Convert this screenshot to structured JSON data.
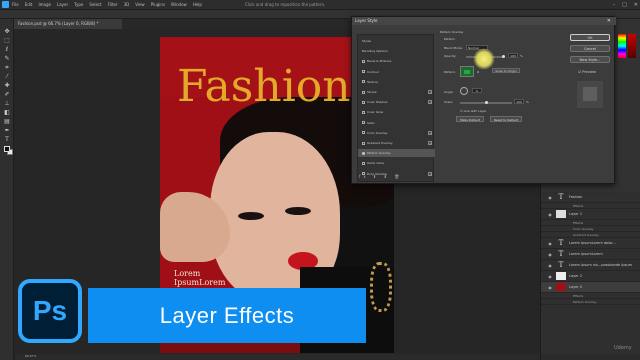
{
  "menubar": {
    "items": [
      "File",
      "Edit",
      "Image",
      "Layer",
      "Type",
      "Select",
      "Filter",
      "3D",
      "View",
      "Plugins",
      "Window",
      "Help"
    ],
    "hint": "Click and drag to reposition the pattern."
  },
  "document": {
    "tab_title": "Fashion.psd @ 66.7% (Layer 0, RGB/8) *",
    "headline": "Fashion",
    "line1": "Lorem",
    "line2": "IpsumLorem",
    "zoom": "66.67%"
  },
  "dialog": {
    "title": "Layer Style",
    "close": "✕",
    "styles": [
      {
        "label": "Styles",
        "checkbox": false,
        "plus": false
      },
      {
        "label": "Blending Options",
        "checkbox": false,
        "plus": false
      },
      {
        "label": "Bevel & Emboss",
        "checkbox": true,
        "plus": false
      },
      {
        "label": "Contour",
        "checkbox": true,
        "plus": false
      },
      {
        "label": "Texture",
        "checkbox": true,
        "plus": false
      },
      {
        "label": "Stroke",
        "checkbox": true,
        "plus": true
      },
      {
        "label": "Inner Shadow",
        "checkbox": true,
        "plus": true
      },
      {
        "label": "Inner Glow",
        "checkbox": true,
        "plus": false
      },
      {
        "label": "Satin",
        "checkbox": true,
        "plus": false
      },
      {
        "label": "Color Overlay",
        "checkbox": true,
        "plus": true
      },
      {
        "label": "Gradient Overlay",
        "checkbox": true,
        "plus": true
      },
      {
        "label": "Pattern Overlay",
        "checkbox": true,
        "plus": false,
        "active": true
      },
      {
        "label": "Outer Glow",
        "checkbox": true,
        "plus": false
      },
      {
        "label": "Drop Shadow",
        "checkbox": true,
        "plus": true
      }
    ],
    "fx_buttons": "fx ⬆ ⬇ 🗑",
    "section_title": "Pattern Overlay",
    "sub_title": "Pattern",
    "blend_mode_label": "Blend Mode:",
    "blend_mode_value": "Normal",
    "opacity_label": "Opacity:",
    "opacity_value": "100",
    "pattern_label": "Pattern:",
    "snap_label": "Snap to Origin",
    "angle_label": "Angle:",
    "angle_value": "0",
    "scale_label": "Scale:",
    "scale_value": "100",
    "link_label": "Link with Layer",
    "make_default": "Make Default",
    "reset_default": "Reset to Default",
    "buttons": {
      "ok": "OK",
      "cancel": "Cancel",
      "new_style": "New Style..."
    },
    "preview_label": "Preview"
  },
  "layers": [
    {
      "kind": "text",
      "name": "Fashion"
    },
    {
      "kind": "sub",
      "name": "Effects"
    },
    {
      "kind": "img",
      "name": "Layer 1"
    },
    {
      "kind": "sub",
      "name": "Effects"
    },
    {
      "kind": "sub",
      "name": "Color Overlay"
    },
    {
      "kind": "sub",
      "name": "Gradient Overlay"
    },
    {
      "kind": "text",
      "name": "Lorem IpsumLorem dolor..."
    },
    {
      "kind": "text",
      "name": "Lorem IpsumLorem"
    },
    {
      "kind": "text",
      "name": "Lorem Ipsum nis...passbonde Ipsum"
    },
    {
      "kind": "img",
      "name": "Layer 2"
    },
    {
      "kind": "img",
      "name": "Layer 0"
    },
    {
      "kind": "sub",
      "name": "Effects"
    },
    {
      "kind": "sub",
      "name": "Pattern Overlay"
    }
  ],
  "overlay": {
    "logo_text": "Ps",
    "banner_text": "Layer Effects",
    "watermark": "Udemy"
  },
  "colors": {
    "ps_blue": "#31a8ff",
    "banner_blue": "#0d8ef0",
    "headline_gold": "#e3a928",
    "doc_red": "#9f0f15"
  }
}
